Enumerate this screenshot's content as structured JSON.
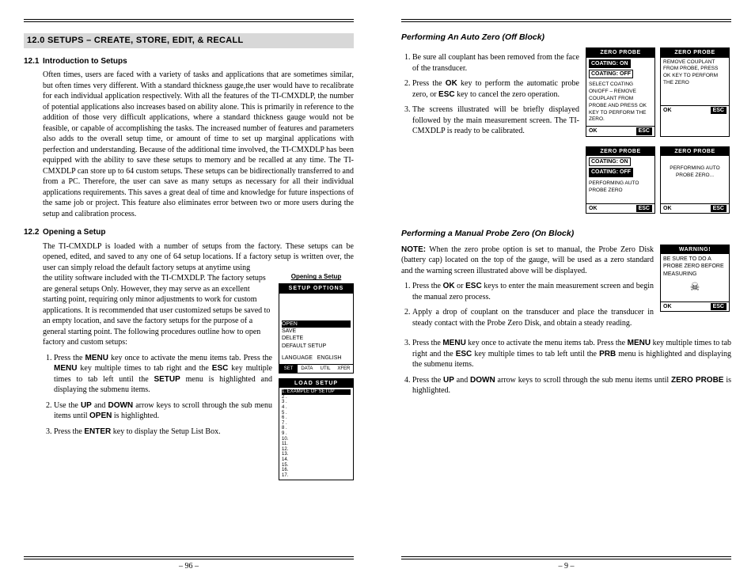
{
  "left": {
    "chapter": "12.0 SETUPS – CREATE, STORE, EDIT, & RECALL",
    "s1": {
      "heading_num": "12.1",
      "heading": "Introduction to Setups",
      "para": "Often times, users are faced with a variety of tasks and applications that are sometimes similar, but often times very different. With a standard thickness gauge,the user would have to recalibrate for each individual application respectively. With all the features of the TI-CMXDLP, the number of potential applications also increases based on ability alone. This is primarily in reference to the addition of those very difficult applications, where a standard thickness gauge would not be feasible, or capable of accomplishing the tasks. The increased number of features and parameters also adds to the overall setup time, or amount of time to set up marginal applications with perfection and understanding. Because of the additional time involved, the TI-CMXDLP has been equipped with the ability to save these setups to memory and be recalled at any time. The TI-CMXDLP can store up to 64 custom setups. These setups can be bidirectionally transferred to and from a PC. Therefore, the user can save as many setups as necessary for all their individual applications requirements. This saves a great deal of time and knowledge for future inspections of the same job or project. This feature also eliminates error between two or more users during the setup and calibration process."
    },
    "s2": {
      "heading_num": "12.2",
      "heading": "Opening a Setup",
      "para1": "The TI-CMXDLP is loaded with a number of setups from the factory. These setups can be opened, edited, and saved to any one of 64 setup locations. If a factory setup is written over, the user can simply reload the default factory setups at anytime using",
      "para2": "the utility software included with the TI-CMXDLP. The factory setups are general setups Only. However, they may serve as an excellent starting point, requiring only minor adjustments to work for custom applications. It is recommended that user customized setups be saved to an empty location, and save the factory setups for the purpose of a general starting point. The following procedures outline how to open factory and custom setups:",
      "fig_cap": "Opening a Setup",
      "setup_title": "SETUP OPTIONS",
      "setup_items": [
        "OPEN",
        "SAVE",
        "DELETE",
        "DEFAULT SETUP"
      ],
      "setup_lang_label": "LANGUAGE",
      "setup_lang_value": "ENGLISH",
      "setup_tabs": [
        "SET",
        "DATA",
        "UTIL",
        "XFER"
      ],
      "load_title": "LOAD SETUP",
      "load_row1": "1. EXAMPLE OF SETUP",
      "load_rows": [
        "2 .",
        "3 .",
        "4 .",
        "5 .",
        "6 .",
        "7 .",
        "8 .",
        "9 .",
        "10.",
        "11.",
        "12.",
        "13.",
        "14.",
        "15.",
        "16.",
        "17."
      ],
      "step1_a": "Press the ",
      "step1_b": " key once to activate the menu items tab. Press the ",
      "step1_c": " key multiple times to tab right and the ",
      "step1_d": " key multiple times to tab left until the ",
      "step1_e": " menu is highlighted and displaying the submenu items.",
      "step2_a": "Use the ",
      "step2_b": " and ",
      "step2_c": " arrow keys to scroll through the sub menu items until ",
      "step2_d": " is highlighted.",
      "step3_a": "Press the ",
      "step3_b": " key to display the Setup List Box.",
      "k_menu": "MENU",
      "k_esc": "ESC",
      "k_setup": "SETUP",
      "k_up": "UP",
      "k_down": "DOWN",
      "k_open": "OPEN",
      "k_enter": "ENTER"
    },
    "page_no": "– 96 –"
  },
  "right": {
    "h1": "Performing An Auto Zero (Off Block)",
    "auto": {
      "step1": "Be sure all couplant has been removed from the face of the transducer.",
      "step2_a": "Press the ",
      "step2_b": " key to perform the automatic probe zero, or ",
      "step2_c": " key to cancel the zero operation.",
      "step3": "The screens illustrated will be briefly displayed followed by the main measurement screen. The TI-CMXDLP is ready to be calibrated.",
      "k_ok": "OK",
      "k_esc": "ESC"
    },
    "lcd_ok": "OK",
    "lcd_esc": "ESC",
    "zp_title": "ZERO PROBE",
    "zp1_l1": "COATING:  ON",
    "zp1_l2": "COATING:  OFF",
    "zp1_body": "SELECT COATING ON/OFF – REMOVE COUPLANT FROM PROBE AND PRESS OK KEY TO PERFORM THE ZERO.",
    "zp2_body": "REMOVE COUPLANT FROM PROBE, PRESS OK KEY TO PERFORM THE ZERO",
    "zp3_l1": "COATING:  ON",
    "zp3_l2": "COATING:  OFF",
    "zp3_body": "PERFORMING AUTO PROBE ZERO",
    "zp4_body": "PERFORMING AUTO PROBE ZERO...",
    "h2": "Performing a Manual Probe Zero (On Block)",
    "note_label": "NOTE:",
    "note_body": " When the zero probe option is set to manual, the Probe Zero Disk (battery cap) located on the top of the gauge, will be used as a zero standard and the warning screen illustrated above will be displayed.",
    "warn_title": "WARNING!",
    "warn_body": "BE SURE TO DO A PROBE ZERO BEFORE MEASURING",
    "man": {
      "step1_a": "Press the ",
      "step1_b": " or ",
      "step1_c": " keys to enter the main measurement screen and begin the manual zero process.",
      "step2": "Apply a drop of couplant on the transducer and place the transducer in steady contact with the Probe Zero Disk, and obtain a steady reading.",
      "step3_a": "Press the ",
      "step3_b": " key once to activate the menu items tab. Press the ",
      "step3_c": " key multiple times to tab right and the ",
      "step3_d": " key multiple times to tab left until the ",
      "step3_e": " menu is highlighted and displaying the submenu items.",
      "step4_a": "Press the ",
      "step4_b": " and ",
      "step4_c": " arrow keys to scroll through the sub menu items until ",
      "step4_d": " is highlighted.",
      "k_ok": "OK",
      "k_esc": "ESC",
      "k_menu": "MENU",
      "k_prb": "PRB",
      "k_up": "UP",
      "k_down": "DOWN",
      "k_zp": "ZERO PROBE"
    },
    "page_no": "– 9 –"
  }
}
